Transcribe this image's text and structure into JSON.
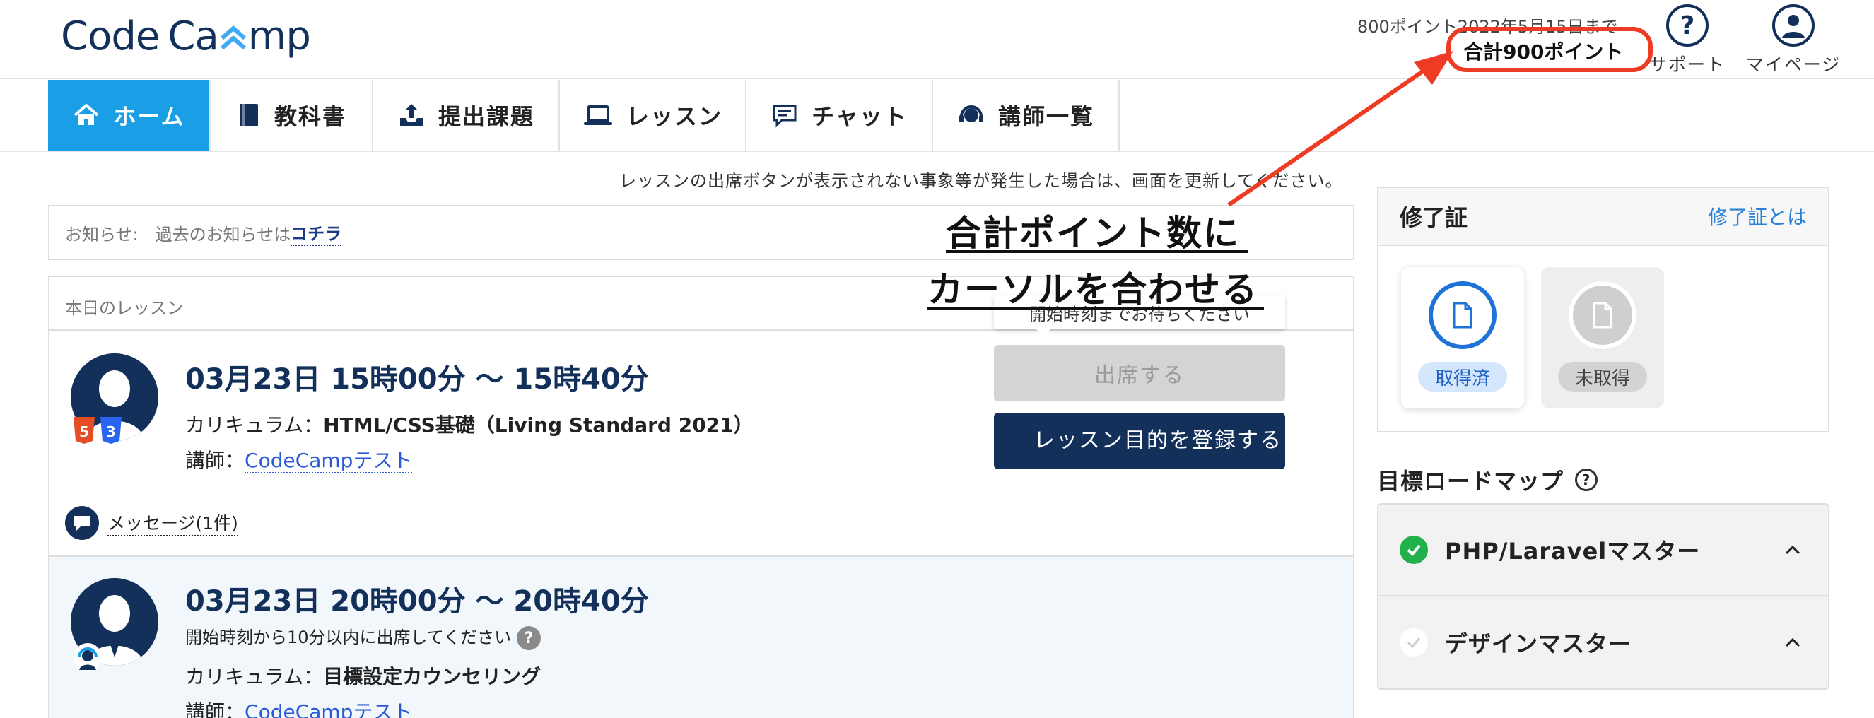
{
  "header": {
    "logo_left": "Code",
    "logo_right": "mp",
    "logo_mid": "Ca",
    "points_note": "800ポイント2022年5月15日まで",
    "points_total": "合計900ポイント",
    "support_label": "サポート",
    "mypage_label": "マイページ"
  },
  "nav": {
    "items": [
      {
        "label": "ホーム",
        "icon": "home-icon",
        "active": true
      },
      {
        "label": "教科書",
        "icon": "book-icon",
        "active": false
      },
      {
        "label": "提出課題",
        "icon": "upload-tray-icon",
        "active": false
      },
      {
        "label": "レッスン",
        "icon": "laptop-icon",
        "active": false
      },
      {
        "label": "チャット",
        "icon": "chat-icon",
        "active": false
      },
      {
        "label": "講師一覧",
        "icon": "headset-icon",
        "active": false
      }
    ]
  },
  "main": {
    "refresh_note": "レッスンの出席ボタンが表示されない事象等が発生した場合は、画面を更新してください。",
    "notice_prefix": "お知らせ:　過去のお知らせは",
    "notice_link": "コチラ",
    "today_title": "本日のレッスン",
    "lessons": [
      {
        "time": "03月23日 15時00分 〜 15時40分",
        "curriculum_label": "カリキュラム：",
        "curriculum": "HTML/CSS基礎（Living Standard 2021）",
        "teacher_label": "講師：",
        "teacher": "CodeCampテスト",
        "message": "メッセージ(1件)"
      },
      {
        "time": "03月23日 20時00分 〜 20時40分",
        "note": "開始時刻から10分以内に出席してください",
        "curriculum_label": "カリキュラム：",
        "curriculum": "目標設定カウンセリング",
        "teacher_label": "講師：",
        "teacher": "CodeCampテスト",
        "tooltip": "開始時刻までお待ちください",
        "attend_button": "出席する",
        "purpose_button": "レッスン目的を登録する"
      }
    ]
  },
  "annotation": {
    "line1": "合計ポイント数に",
    "line2": "カーソルを合わせる",
    "color": "#ee3b23"
  },
  "certificate": {
    "title": "修了証",
    "link": "修了証とは",
    "badges": [
      {
        "label": "取得済",
        "icon": "document-icon"
      },
      {
        "label": "未取得",
        "icon": "document-icon"
      }
    ]
  },
  "roadmap": {
    "title": "目標ロードマップ",
    "items": [
      {
        "label": "PHP/Laravelマスター",
        "done": true
      },
      {
        "label": "デザインマスター",
        "done": false
      }
    ]
  },
  "colors": {
    "brand_navy": "#12305a",
    "nav_active": "#1a9ee6",
    "link_blue": "#2a59d6",
    "success_green": "#22b04b"
  }
}
